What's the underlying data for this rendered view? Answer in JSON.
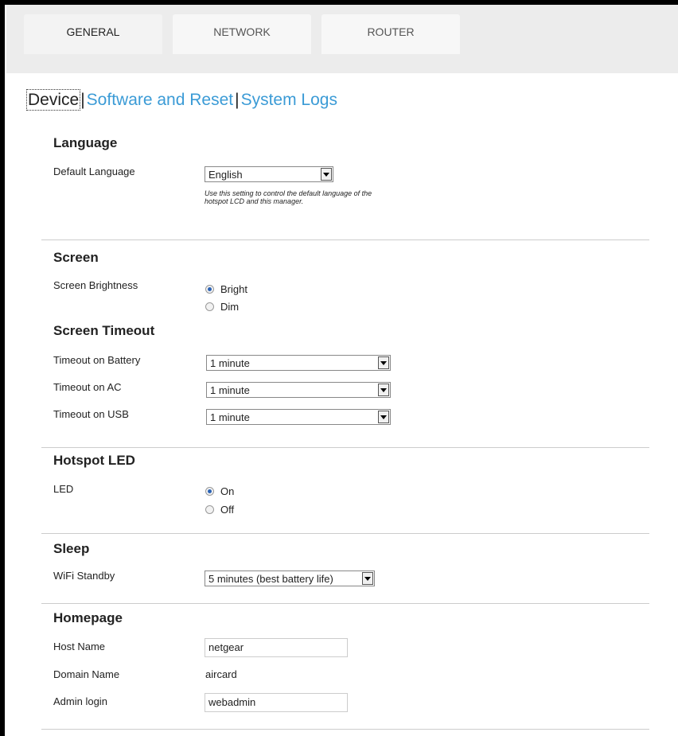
{
  "tabs": [
    {
      "label": "GENERAL",
      "active": true
    },
    {
      "label": "NETWORK",
      "active": false
    },
    {
      "label": "ROUTER",
      "active": false
    }
  ],
  "subnav": {
    "items": [
      "Device",
      "Software and Reset",
      "System Logs"
    ],
    "separator": "|",
    "active": "Device"
  },
  "language": {
    "title": "Language",
    "default_label": "Default Language",
    "default_value": "English",
    "help": "Use this setting to control the default language of the hotspot LCD and this manager."
  },
  "screen": {
    "title": "Screen",
    "brightness_label": "Screen Brightness",
    "options": [
      "Bright",
      "Dim"
    ],
    "selected": "Bright"
  },
  "timeout": {
    "title": "Screen Timeout",
    "battery_label": "Timeout on Battery",
    "battery_value": "1 minute",
    "ac_label": "Timeout on AC",
    "ac_value": "1 minute",
    "usb_label": "Timeout on USB",
    "usb_value": "1 minute"
  },
  "led": {
    "title": "Hotspot LED",
    "label": "LED",
    "options": [
      "On",
      "Off"
    ],
    "selected": "On"
  },
  "sleep": {
    "title": "Sleep",
    "wifi_label": "WiFi Standby",
    "wifi_value": "5 minutes (best battery life)"
  },
  "homepage": {
    "title": "Homepage",
    "host_label": "Host Name",
    "host_value": "netgear",
    "domain_label": "Domain Name",
    "domain_value": "aircard",
    "admin_label": "Admin login",
    "admin_value": "webadmin"
  },
  "colors": {
    "link": "#3b9bd6",
    "tab_bar": "#ececec",
    "radio_checked": "#2b63b5"
  }
}
